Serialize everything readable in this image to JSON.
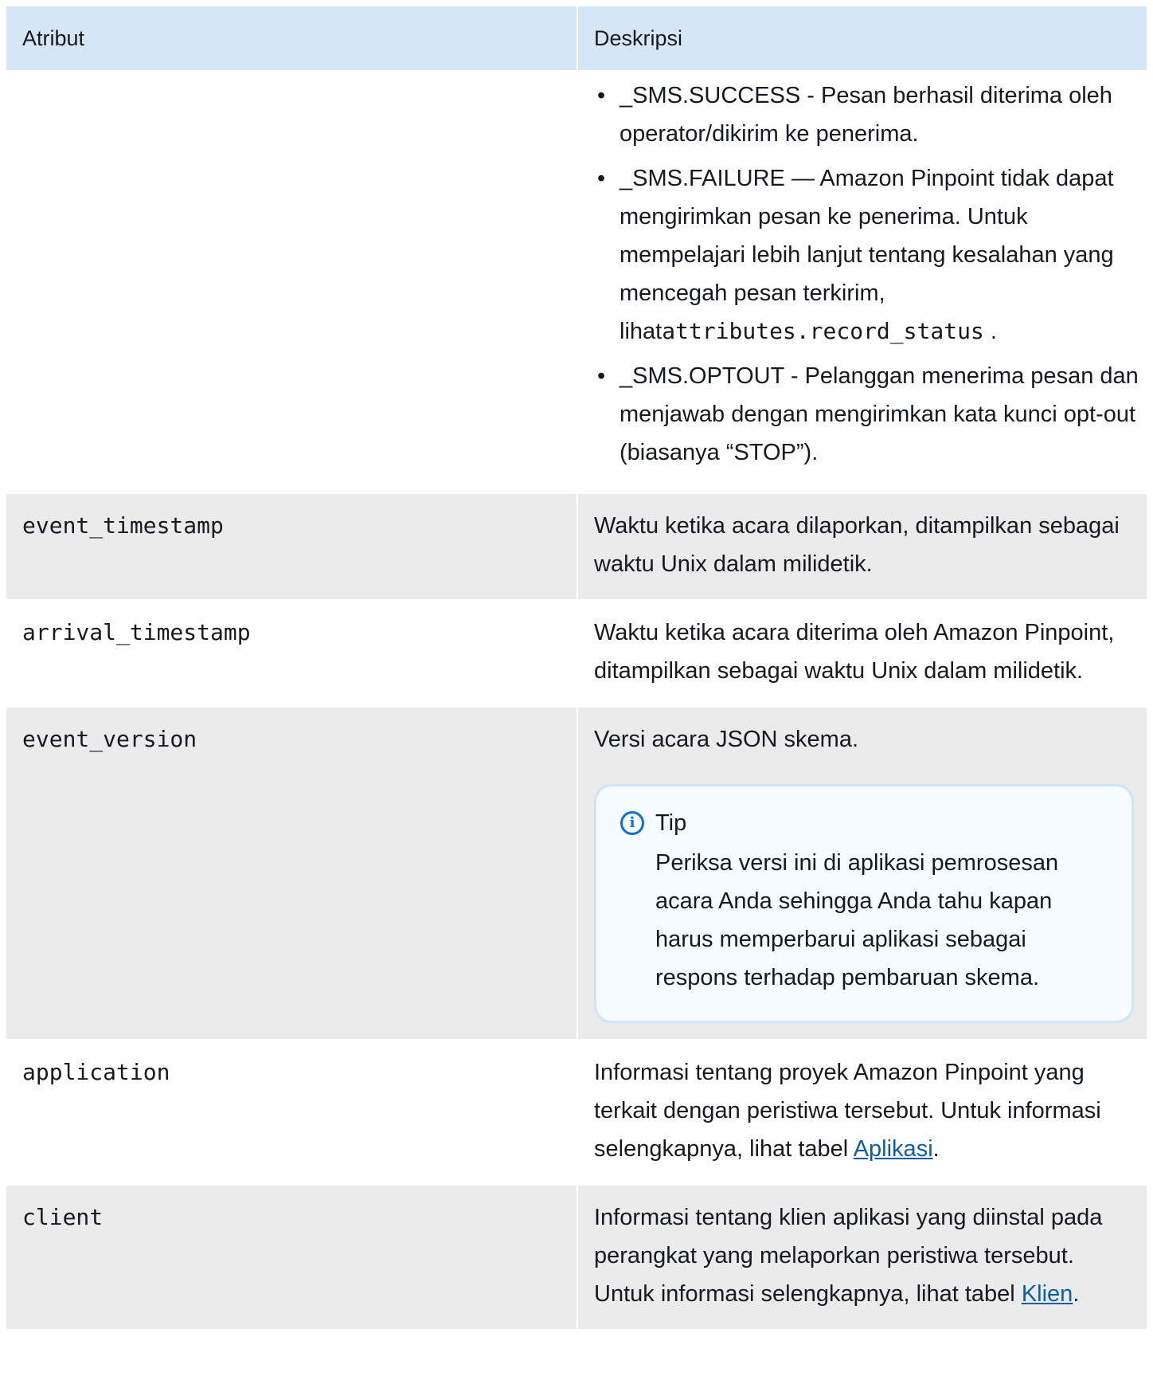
{
  "header": {
    "col1": "Atribut",
    "col2": "Deskripsi"
  },
  "row0": {
    "items": [
      {
        "text": "_SMS.SUCCESS - Pesan berhasil diterima oleh operator/dikirim ke penerima."
      },
      {
        "text": "_SMS.FAILURE — Amazon Pinpoint tidak dapat mengirimkan pesan ke penerima. Untuk mempelajari lebih lanjut tentang kesalahan yang mencegah pesan terkirim, lihat",
        "code": "attributes.record_status",
        "after": " ."
      },
      {
        "text": "_SMS.OPTOUT - Pelanggan menerima pesan dan menjawab dengan mengirimkan kata kunci opt-out (biasanya “STOP”)."
      }
    ]
  },
  "rows": [
    {
      "attr": "event_timestamp",
      "desc": "Waktu ketika acara dilaporkan, ditampilkan sebagai waktu Unix dalam milidetik."
    },
    {
      "attr": "arrival_timestamp",
      "desc": "Waktu ketika acara diterima oleh Amazon Pinpoint, ditampilkan sebagai waktu Unix dalam milidetik."
    },
    {
      "attr": "event_version",
      "desc": "Versi acara JSON skema.",
      "tip": {
        "title": "Tip",
        "body": "Periksa versi ini di aplikasi pemrosesan acara Anda sehingga Anda tahu kapan harus memperbarui aplikasi sebagai respons terhadap pembaruan skema."
      }
    },
    {
      "attr": "application",
      "desc": "Informasi tentang proyek Amazon Pinpoint yang terkait dengan peristiwa tersebut. Untuk informasi selengkapnya, lihat tabel",
      "link": "Aplikasi",
      "after": "."
    },
    {
      "attr": "client",
      "desc": "Informasi tentang klien aplikasi yang diinstal pada perangkat yang melaporkan peristiwa tersebut. Untuk informasi selengkapnya, lihat tabel",
      "link": "Klien",
      "after": "."
    }
  ]
}
